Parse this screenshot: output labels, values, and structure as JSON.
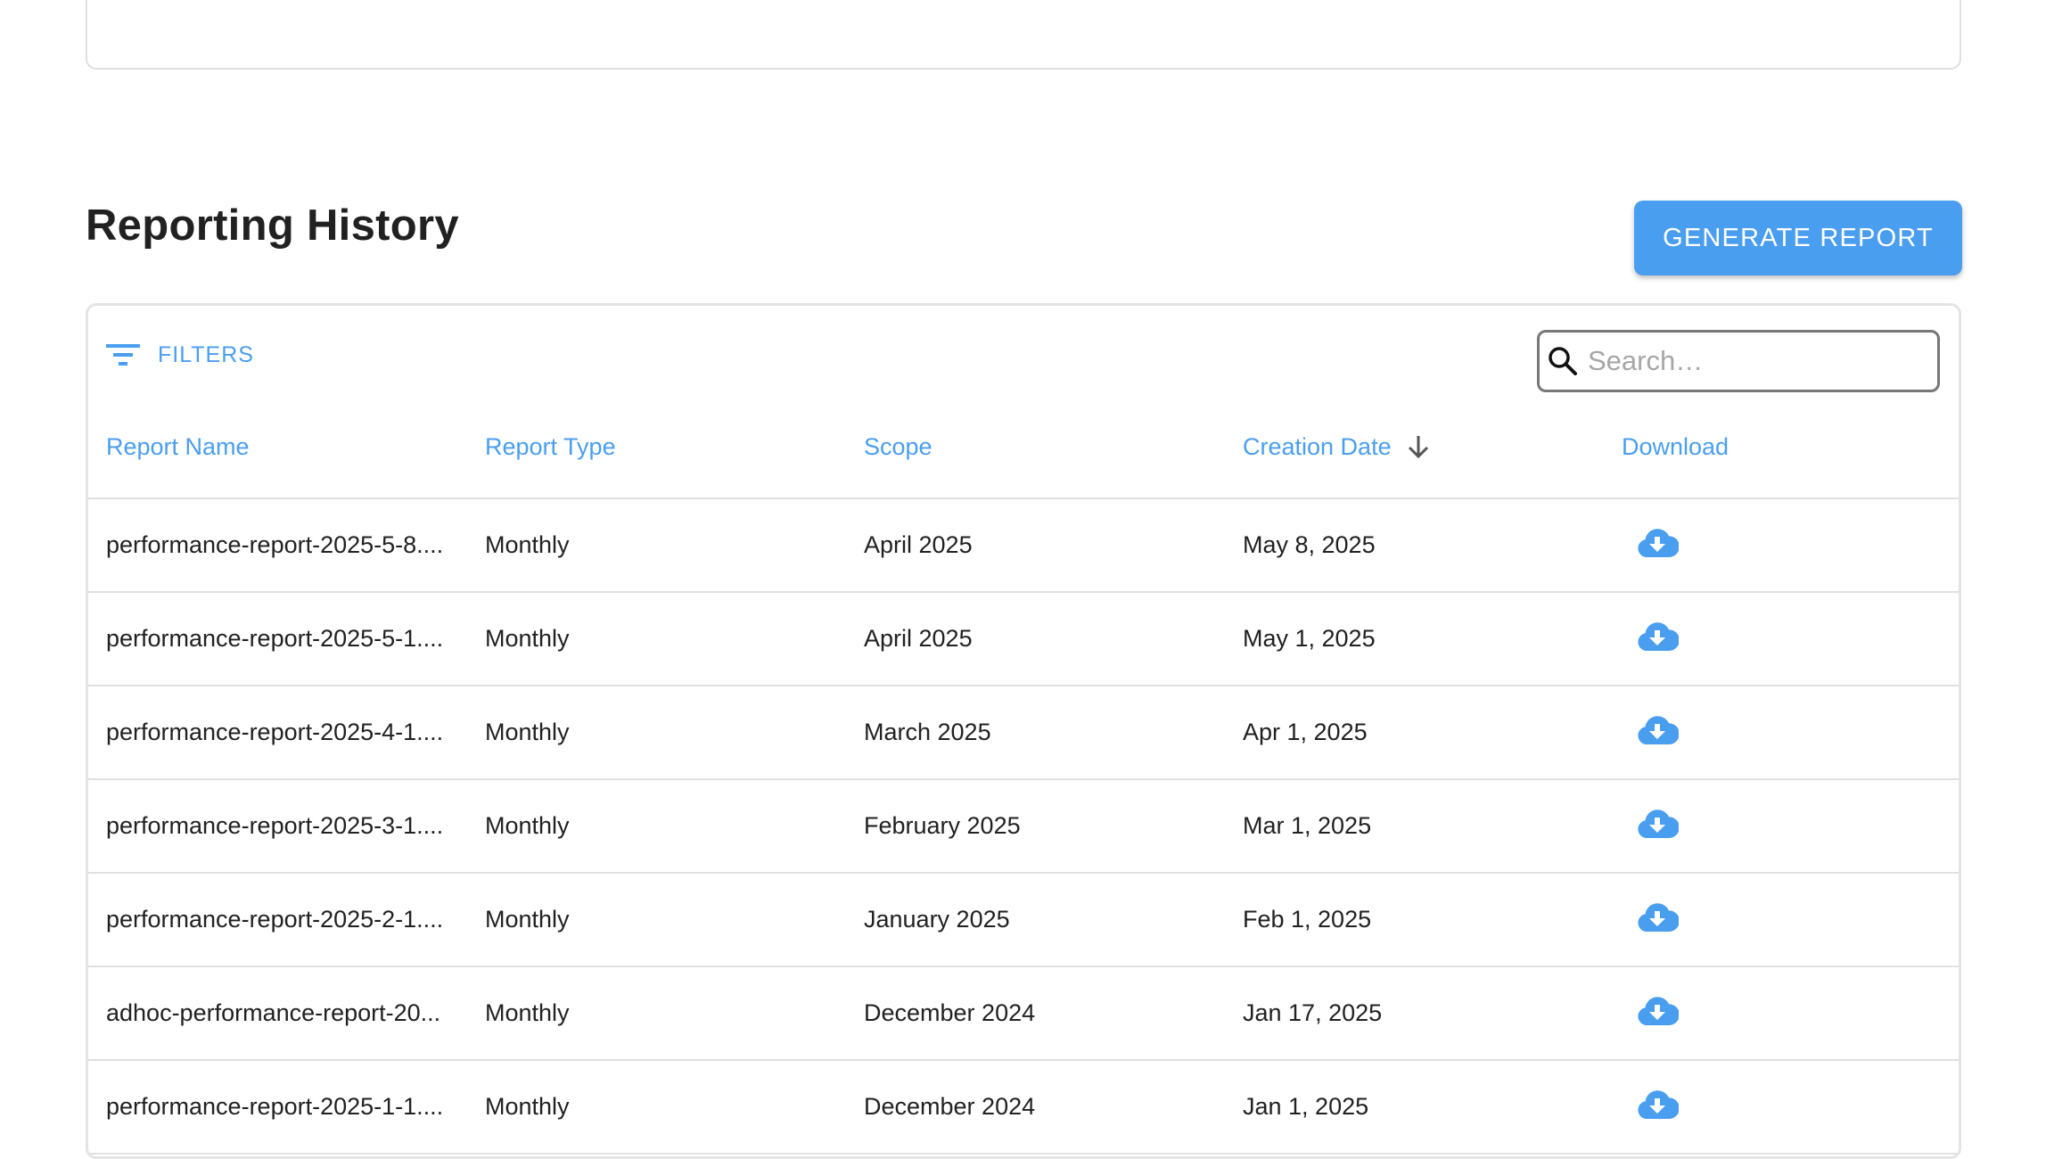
{
  "section": {
    "title": "Reporting History",
    "generate_label": "GENERATE REPORT"
  },
  "toolbar": {
    "filters_label": "FILTERS",
    "search_placeholder": "Search…",
    "search_value": ""
  },
  "columns": [
    "Report Name",
    "Report Type",
    "Scope",
    "Creation Date",
    "Download"
  ],
  "sort": {
    "column": "Creation Date",
    "direction": "descending"
  },
  "rows": [
    {
      "name": "performance-report-2025-5-8....",
      "type": "Monthly",
      "scope": "April 2025",
      "date": "May 8, 2025"
    },
    {
      "name": "performance-report-2025-5-1....",
      "type": "Monthly",
      "scope": "April 2025",
      "date": "May 1, 2025"
    },
    {
      "name": "performance-report-2025-4-1....",
      "type": "Monthly",
      "scope": "March 2025",
      "date": "Apr 1, 2025"
    },
    {
      "name": "performance-report-2025-3-1....",
      "type": "Monthly",
      "scope": "February 2025",
      "date": "Mar 1, 2025"
    },
    {
      "name": "performance-report-2025-2-1....",
      "type": "Monthly",
      "scope": "January 2025",
      "date": "Feb 1, 2025"
    },
    {
      "name": "adhoc-performance-report-20...",
      "type": "Monthly",
      "scope": "December 2024",
      "date": "Jan 17, 2025"
    },
    {
      "name": "performance-report-2025-1-1....",
      "type": "Monthly",
      "scope": "December 2024",
      "date": "Jan 1, 2025"
    }
  ],
  "icons": {
    "filter": "filter-list-icon",
    "search": "search-icon",
    "sort": "arrow-down-icon",
    "download": "cloud-download-icon"
  },
  "colors": {
    "accent": "#4a9eef",
    "text": "#212121",
    "border": "#e0e0e0"
  }
}
